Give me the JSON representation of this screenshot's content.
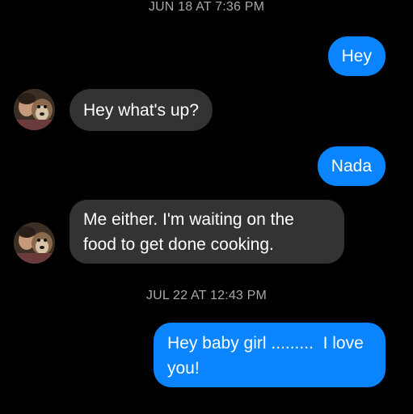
{
  "conversation": {
    "timestamps": {
      "first": "JUN 18 AT 7:36 PM",
      "second": "JUL 22 AT 12:43 PM"
    },
    "messages": [
      {
        "sender": "me",
        "text": "Hey"
      },
      {
        "sender": "them",
        "text": "Hey what's up?"
      },
      {
        "sender": "me",
        "text": "Nada"
      },
      {
        "sender": "them",
        "text": "Me either. I'm waiting on the food to get done cooking."
      },
      {
        "sender": "me",
        "text": "Hey baby girl .........  I love you!"
      }
    ]
  },
  "theme": {
    "background": "#000000",
    "sent_bubble": "#0a84ff",
    "received_bubble": "#333335",
    "timestamp_text": "#a8a8a8"
  },
  "icons": {
    "avatar": "contact-avatar-photo"
  }
}
